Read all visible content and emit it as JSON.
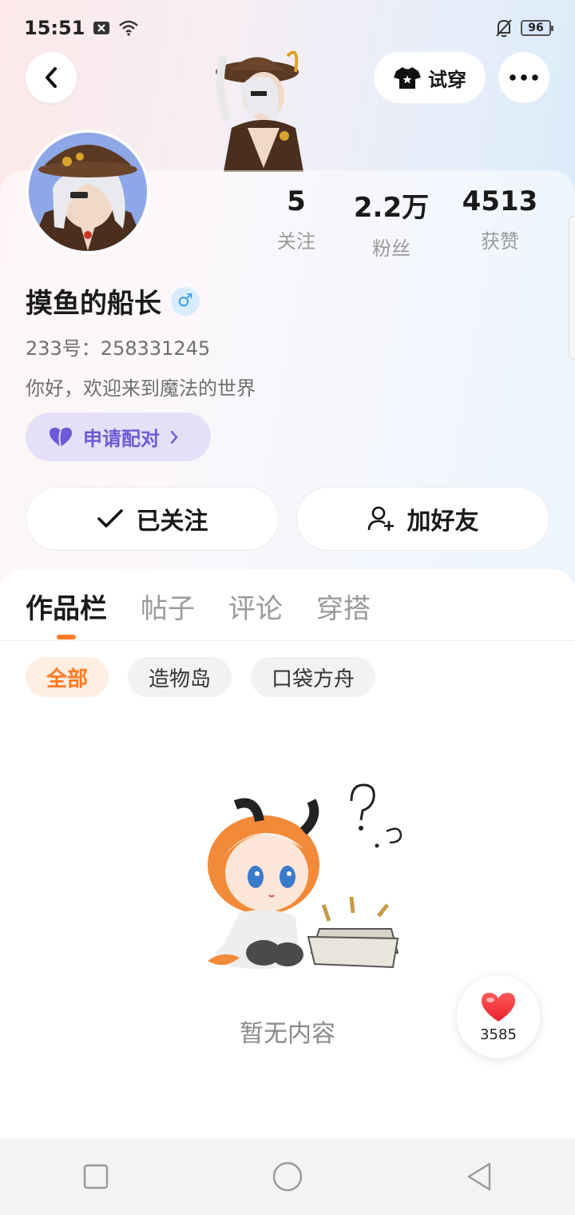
{
  "status_bar": {
    "time": "15:51",
    "battery": "96"
  },
  "top_nav": {
    "try_on_label": "试穿"
  },
  "profile": {
    "name": "摸鱼的船长",
    "gender_symbol": "♂",
    "user_id": "233号：258331245",
    "bio": "你好，欢迎来到魔法的世界",
    "pair_label": "申请配对",
    "stats": [
      {
        "value": "5",
        "label": "关注"
      },
      {
        "value": "2.2万",
        "label": "粉丝"
      },
      {
        "value": "4513",
        "label": "获赞"
      }
    ],
    "follow_label": "已关注",
    "add_friend_label": "加好友"
  },
  "tabs": [
    {
      "label": "作品栏",
      "active": true
    },
    {
      "label": "帖子",
      "active": false
    },
    {
      "label": "评论",
      "active": false
    },
    {
      "label": "穿搭",
      "active": false
    }
  ],
  "filters": [
    {
      "label": "全部",
      "active": true
    },
    {
      "label": "造物岛",
      "active": false
    },
    {
      "label": "口袋方舟",
      "active": false
    }
  ],
  "empty_state": {
    "text": "暂无内容"
  },
  "like_fab": {
    "count": "3585"
  },
  "colors": {
    "accent": "#ff7a25",
    "pair": "#6d5ad6",
    "gender": "#3d9be9"
  },
  "icons": [
    "back-arrow-icon",
    "tshirt-icon",
    "more-dots-icon",
    "check-icon",
    "add-user-icon",
    "heart-icon",
    "chevron-right-icon"
  ]
}
